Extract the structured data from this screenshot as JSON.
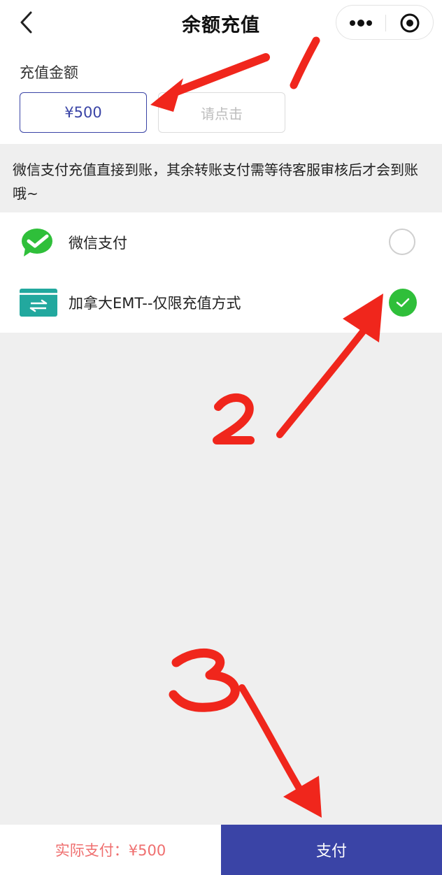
{
  "header": {
    "title": "余额充值",
    "back_icon": "chevron-left-icon",
    "more_icon": "more-dots-icon",
    "close_icon": "target-circle-icon"
  },
  "amount": {
    "label": "充值金额",
    "selected_value": "¥500",
    "custom_placeholder": "请点击"
  },
  "notice": {
    "text": "微信支付充值直接到账，其余转账支付需等待客服审核后才会到账哦~"
  },
  "payment_methods": [
    {
      "label": "微信支付",
      "icon": "wechat-pay-icon",
      "selected": false
    },
    {
      "label": "加拿大EMT--仅限充值方式",
      "icon": "bank-transfer-icon",
      "selected": true
    }
  ],
  "bottom": {
    "actual_pay_label": "实际支付：¥500",
    "pay_button_label": "支付"
  },
  "colors": {
    "accent": "#3a44a6",
    "success": "#2fbf3a",
    "price_text": "#ef6f6f",
    "annotation_red": "#f0261c"
  },
  "annotations": [
    "1",
    "2",
    "3"
  ]
}
